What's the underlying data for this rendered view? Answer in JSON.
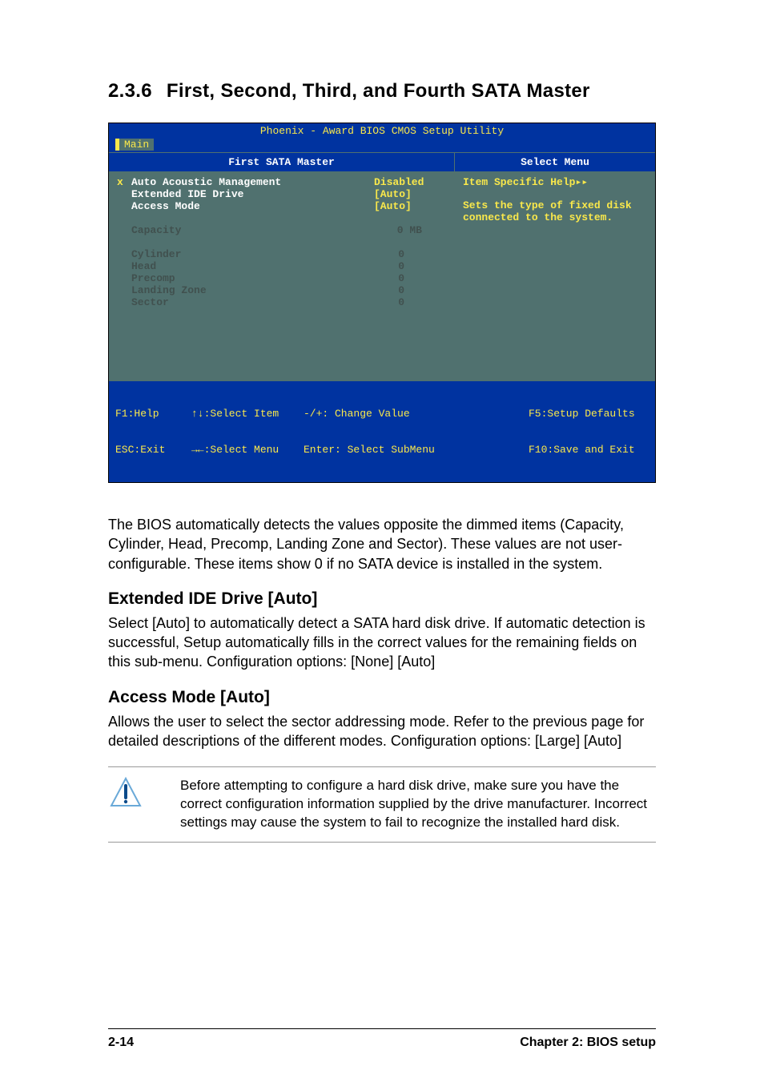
{
  "section": {
    "number": "2.3.6",
    "title": "First, Second, Third, and Fourth SATA Master"
  },
  "bios": {
    "title": "Phoenix - Award BIOS CMOS Setup Utility",
    "menu_tab": "Main",
    "left_header": "First SATA Master",
    "right_header": "Select Menu",
    "items": {
      "auto_acoustic": {
        "label": "Auto Acoustic Management",
        "value": "Disabled",
        "marker": "x",
        "dim": false
      },
      "extended_ide": {
        "label": "Extended IDE Drive",
        "value": "[Auto]",
        "marker": "",
        "dim": false
      },
      "access_mode": {
        "label": "Access Mode",
        "value": "[Auto]",
        "marker": "",
        "dim": false
      },
      "capacity": {
        "label": "Capacity",
        "value": "0 MB",
        "marker": "",
        "dim": true
      },
      "cylinder": {
        "label": "Cylinder",
        "value": "0",
        "marker": "",
        "dim": true
      },
      "head": {
        "label": "Head",
        "value": "0",
        "marker": "",
        "dim": true
      },
      "precomp": {
        "label": "Precomp",
        "value": "0",
        "marker": "",
        "dim": true
      },
      "landing": {
        "label": "Landing Zone",
        "value": "0",
        "marker": "",
        "dim": true
      },
      "sector": {
        "label": "Sector",
        "value": "0",
        "marker": "",
        "dim": true
      }
    },
    "help": {
      "title": "Item Specific Help",
      "body": "Sets the type of fixed disk connected to the system."
    },
    "footer": {
      "f1": "F1:Help",
      "esc": "ESC:Exit",
      "updown": "↑↓:Select Item",
      "leftright": "→←:Select Menu",
      "plusminus": "-/+: Change Value",
      "enter": "Enter: Select SubMenu",
      "f5": "F5:Setup Defaults",
      "f10": "F10:Save and Exit"
    }
  },
  "para1": "The BIOS automatically detects the values opposite the dimmed items (Capacity, Cylinder,  Head, Precomp, Landing Zone and Sector). These values are not user-configurable. These items show 0 if no SATA device is installed in the system.",
  "sub1": {
    "title": "Extended IDE Drive [Auto]",
    "body": "Select [Auto] to automatically detect a SATA hard disk drive. If automatic detection is successful, Setup automatically fills in the correct values for the remaining fields on this sub-menu. Configuration options: [None] [Auto]"
  },
  "sub2": {
    "title": "Access Mode [Auto]",
    "body": "Allows the user to select the sector addressing mode. Refer to the previous page for detailed descriptions of the different modes. Configuration options: [Large] [Auto]"
  },
  "note": "Before attempting to configure a hard disk drive, make sure you have the correct configuration information supplied by the drive manufacturer. Incorrect settings may cause the system to fail to recognize the installed hard disk.",
  "footer": {
    "page": "2-14",
    "chapter": "Chapter 2: BIOS setup"
  }
}
